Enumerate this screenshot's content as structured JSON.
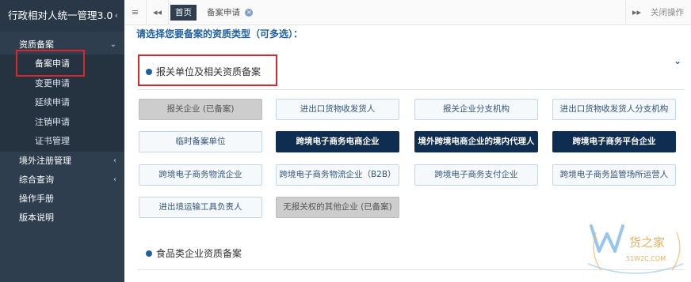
{
  "sidebar": {
    "title": "行政相对人统一管理3.0",
    "title_chevron": "‹",
    "groups": [
      {
        "label": "资质备案",
        "arrow": "⌄"
      },
      {
        "label": "境外注册管理",
        "arrow": "‹"
      },
      {
        "label": "综合查询",
        "arrow": "‹"
      },
      {
        "label": "操作手册"
      },
      {
        "label": "版本说明"
      }
    ],
    "sub_items": [
      "备案申请",
      "变更申请",
      "延续申请",
      "注销申请",
      "证书管理"
    ]
  },
  "topbar": {
    "menu_icon": "≡",
    "back_icon": "◂◂",
    "home_tab": "首页",
    "current_tab": "备案申请",
    "close_glyph": "×",
    "forward_icon": "▸▸",
    "close_ops": "关闭操作"
  },
  "main": {
    "prompt": "请选择您要备案的资质类型（可多选）：",
    "collapse_icon": "⌄",
    "section1": "报关单位及相关资质备案",
    "section2": "食品类企业资质备案",
    "options": [
      {
        "label": "报关企业 (已备案)",
        "state": "filed"
      },
      {
        "label": "进出口货物收发货人",
        "state": "normal"
      },
      {
        "label": "报关企业分支机构",
        "state": "normal"
      },
      {
        "label": "进出口货物收发货人分支机构",
        "state": "normal"
      },
      {
        "label": "临时备案单位",
        "state": "normal"
      },
      {
        "label": "跨境电子商务电商企业",
        "state": "selected"
      },
      {
        "label": "境外跨境电商企业的境内代理人",
        "state": "selected"
      },
      {
        "label": "跨境电子商务平台企业",
        "state": "selected"
      },
      {
        "label": "跨境电子商务物流企业",
        "state": "normal"
      },
      {
        "label": "跨境电子商务物流企业（B2B）",
        "state": "normal"
      },
      {
        "label": "跨境电子商务支付企业",
        "state": "normal"
      },
      {
        "label": "跨境电子商务监管场所运营人",
        "state": "normal"
      },
      {
        "label": "进出境运输工具负责人",
        "state": "normal"
      },
      {
        "label": "无报关权的其他企业 (已备案)",
        "state": "filed"
      }
    ]
  },
  "watermark": {
    "text": "货之家",
    "url": "51W2C.COM"
  },
  "colors": {
    "sidebar_bg": "#2f3e4f",
    "accent": "#1f5f9c",
    "selected": "#0f2d50",
    "highlight": "#d9272e"
  }
}
